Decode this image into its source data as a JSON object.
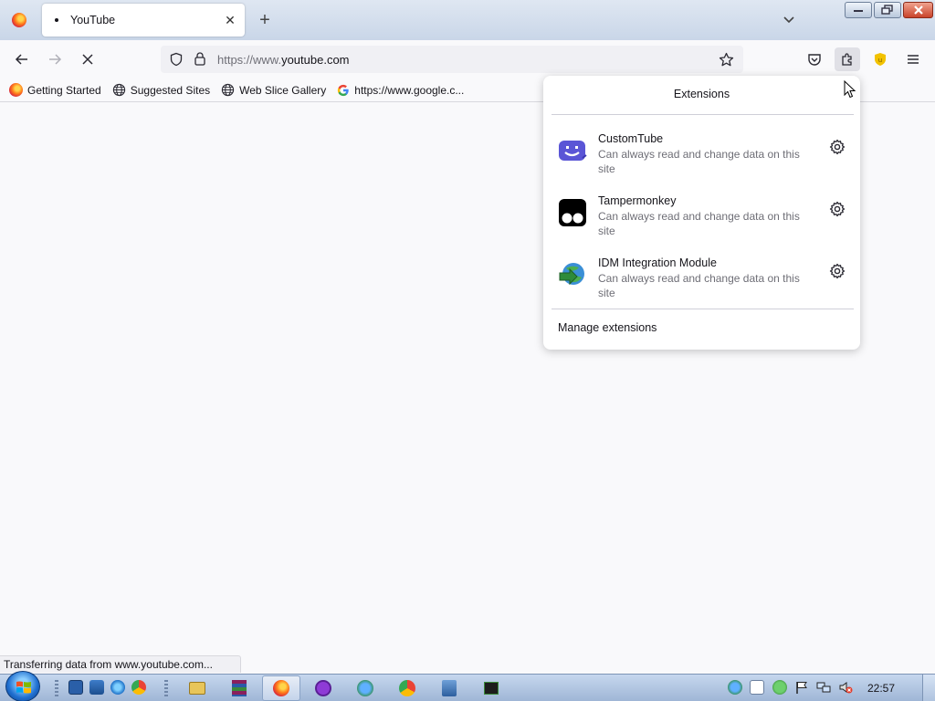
{
  "tab": {
    "title": "YouTube",
    "close_glyph": "✕",
    "new_tab_glyph": "+"
  },
  "navbar": {
    "url_protocol": "https://www.",
    "url_host": "youtube.com"
  },
  "bookmarks": [
    {
      "label": "Getting Started",
      "icon": "firefox-icon"
    },
    {
      "label": "Suggested Sites",
      "icon": "globe-icon"
    },
    {
      "label": "Web Slice Gallery",
      "icon": "globe-icon"
    },
    {
      "label": "https://www.google.c...",
      "icon": "google-icon"
    }
  ],
  "extensions_panel": {
    "title": "Extensions",
    "items": [
      {
        "name": "CustomTube",
        "description": "Can always read and change data on this site",
        "icon": "customtube-icon",
        "color": "#5a55d6"
      },
      {
        "name": "Tampermonkey",
        "description": "Can always read and change data on this site",
        "icon": "tampermonkey-icon",
        "color": "#000000"
      },
      {
        "name": "IDM Integration Module",
        "description": "Can always read and change data on this site",
        "icon": "idm-icon",
        "color": "#2e8b3a"
      }
    ],
    "manage_label": "Manage extensions"
  },
  "status_text": "Transferring data from www.youtube.com...",
  "taskbar": {
    "clock": "22:57"
  },
  "colors": {
    "accent": "#5a55d6",
    "ublock": "#f2c200"
  }
}
